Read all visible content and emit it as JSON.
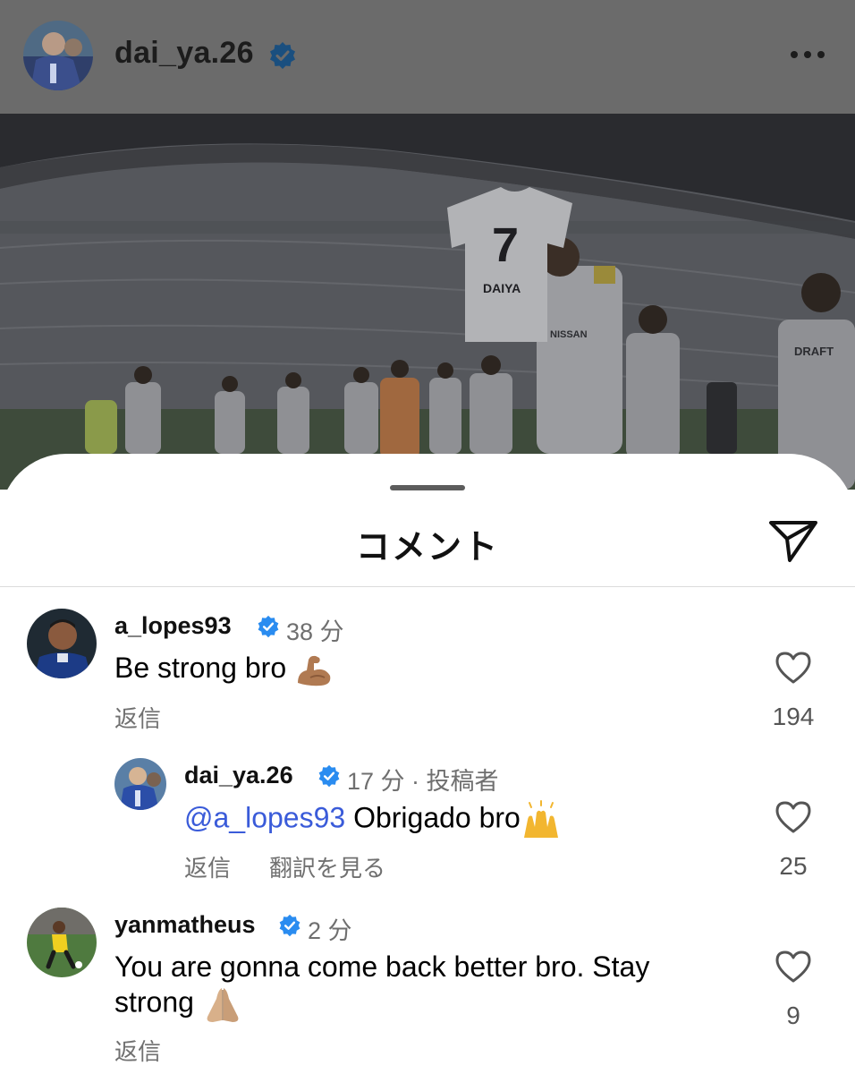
{
  "post": {
    "username": "dai_ya.26",
    "verified_icon": "verified-badge-icon",
    "more_icon": "more-dots-icon",
    "photo": {
      "jersey_number": "7",
      "jersey_name": "DAIYA",
      "sponsor": "DRAFT",
      "shirt_sponsor": "NISSAN"
    }
  },
  "sheet": {
    "title": "コメント",
    "share_icon": "paper-plane-share-icon"
  },
  "comments": [
    {
      "username": "a_lopes93",
      "time": "38 分",
      "text": "Be strong bro ",
      "emoji": "flexed-biceps",
      "reply_label": "返信",
      "like_count": "194"
    },
    {
      "username": "dai_ya.26",
      "time": "17 分 · 投稿者",
      "mention": "@a_lopes93",
      "text": " Obrigado bro",
      "emoji": "raising-hands",
      "reply_label": "返信",
      "translate_label": "翻訳を見る",
      "like_count": "25"
    },
    {
      "username": "yanmatheus",
      "time": "2 分",
      "text_line1": "You are gonna come back better bro. Stay",
      "text_line2": "strong ",
      "emoji": "folded-hands",
      "reply_label": "返信",
      "like_count": "9"
    }
  ],
  "colors": {
    "verified": "#2a8cf0",
    "mention": "#3a5bd9",
    "muted_text": "#707070",
    "divider": "#dbdbdb"
  }
}
